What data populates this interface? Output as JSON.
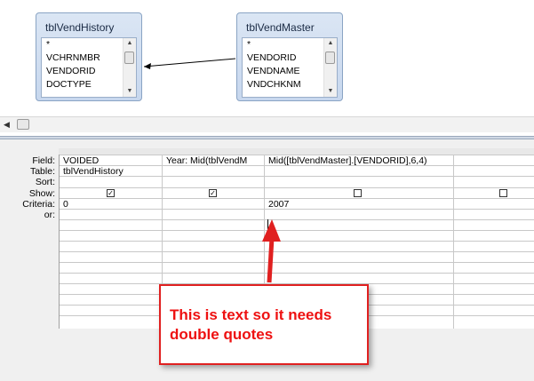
{
  "tables": [
    {
      "name": "tblVendHistory",
      "fields": [
        "*",
        "VCHRNMBR",
        "VENDORID",
        "DOCTYPE"
      ]
    },
    {
      "name": "tblVendMaster",
      "fields": [
        "*",
        "VENDORID",
        "VENDNAME",
        "VNDCHKNM"
      ]
    }
  ],
  "grid": {
    "row_labels": [
      "Field:",
      "Table:",
      "Sort:",
      "Show:",
      "Criteria:",
      "or:"
    ],
    "columns": [
      {
        "field": "VOIDED",
        "table": "tblVendHistory",
        "sort": "",
        "show": true,
        "criteria": "0"
      },
      {
        "field": "Year: Mid(tblVendM",
        "table": "",
        "sort": "",
        "show": true,
        "criteria": ""
      },
      {
        "field": "Mid([tblVendMaster].[VENDORID],6,4)",
        "table": "",
        "sort": "",
        "show": false,
        "criteria": "2007"
      },
      {
        "field": "",
        "table": "",
        "sort": "",
        "show": false,
        "criteria": ""
      }
    ]
  },
  "annotation": {
    "text": "This is text so it needs\ndouble quotes",
    "color": "#ee1111",
    "border_color": "#e02020"
  }
}
